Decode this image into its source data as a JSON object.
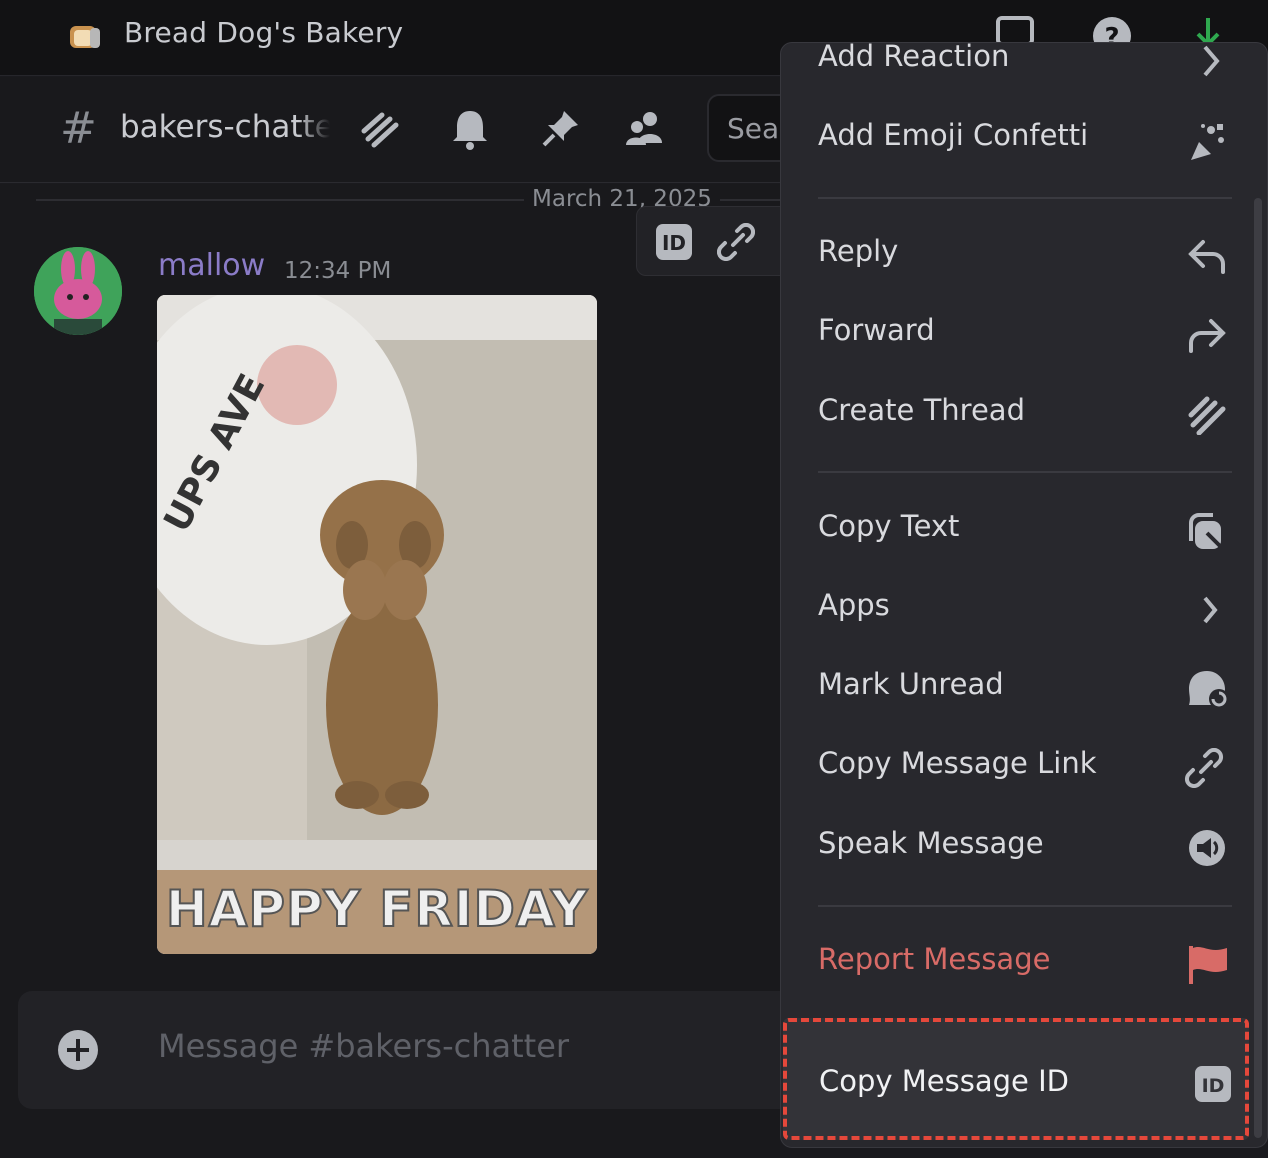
{
  "titlebar": {
    "server_name": "Bread Dog's Bakery",
    "icons": [
      "server-icon",
      "inbox-icon",
      "help-icon",
      "download-icon"
    ],
    "download_color": "#2fa84f"
  },
  "channel_header": {
    "hash": "#",
    "channel_name": "bakers-chatter",
    "icons": [
      "threads-icon",
      "bell-icon",
      "pin-icon",
      "members-icon"
    ],
    "search_placeholder": "Search"
  },
  "messages": {
    "date_divider": "March 21, 2025",
    "hover_toolbar_icons": [
      "id-icon",
      "link-icon"
    ],
    "message": {
      "author": "mallow",
      "author_color": "#8b7cc8",
      "time": "12:34 PM",
      "gif_caption": "HAPPY FRIDAY",
      "gif_pillow_text": "UPS AVE"
    }
  },
  "composer": {
    "placeholder": "Message #bakers-chatter"
  },
  "context_menu": {
    "items": [
      {
        "label": "Add Reaction",
        "icon": "chevron-right-icon"
      },
      {
        "label": "Add Emoji Confetti",
        "icon": "confetti-icon"
      },
      {
        "label": "Reply",
        "icon": "reply-icon"
      },
      {
        "label": "Forward",
        "icon": "forward-icon"
      },
      {
        "label": "Create Thread",
        "icon": "thread-icon"
      },
      {
        "label": "Copy Text",
        "icon": "copy-icon"
      },
      {
        "label": "Apps",
        "icon": "chevron-right-icon"
      },
      {
        "label": "Mark Unread",
        "icon": "mark-unread-icon"
      },
      {
        "label": "Copy Message Link",
        "icon": "link-icon"
      },
      {
        "label": "Speak Message",
        "icon": "speaker-icon"
      },
      {
        "label": "Report Message",
        "icon": "flag-icon",
        "color": "#d86b67"
      },
      {
        "label": "Copy Message ID",
        "icon": "id-icon"
      }
    ],
    "highlight_color": "#e5483b"
  }
}
